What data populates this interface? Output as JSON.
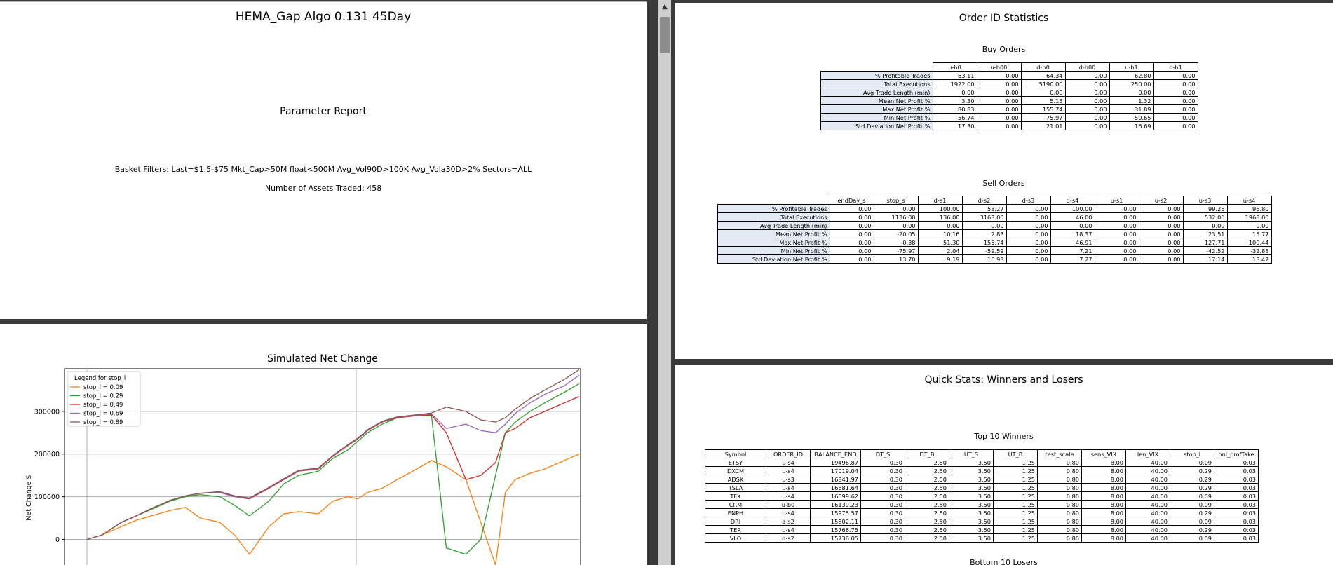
{
  "report": {
    "title": "HEMA_Gap Algo 0.131 45Day",
    "subtitle": "Parameter Report",
    "filters": "Basket Filters: Last=$1.5-$75  Mkt_Cap>50M  float<500M  Avg_Vol90D>100K  Avg_Vola30D>2%  Sectors=ALL",
    "assets": "Number of Assets Traded: 458"
  },
  "order_stats": {
    "title": "Order ID Statistics",
    "row_labels": [
      "% Profitable Trades",
      "Total Executions",
      "Avg Trade Length (min)",
      "Mean Net Profit %",
      "Max Net Profit %",
      "Min Net Profit %",
      "Std Deviation Net Profit %"
    ],
    "buy": {
      "title": "Buy Orders",
      "columns": [
        "u-b0",
        "u-b00",
        "d-b0",
        "d-b00",
        "u-b1",
        "d-b1"
      ],
      "rows": [
        [
          "63.11",
          "0.00",
          "64.34",
          "0.00",
          "62.80",
          "0.00"
        ],
        [
          "1922.00",
          "0.00",
          "5190.00",
          "0.00",
          "250.00",
          "0.00"
        ],
        [
          "0.00",
          "0.00",
          "0.00",
          "0.00",
          "0.00",
          "0.00"
        ],
        [
          "3.30",
          "0.00",
          "5.15",
          "0.00",
          "1.32",
          "0.00"
        ],
        [
          "80.83",
          "0.00",
          "155.74",
          "0.00",
          "31.89",
          "0.00"
        ],
        [
          "-56.74",
          "0.00",
          "-75.97",
          "0.00",
          "-50.65",
          "0.00"
        ],
        [
          "17.30",
          "0.00",
          "21.01",
          "0.00",
          "16.69",
          "0.00"
        ]
      ]
    },
    "sell": {
      "title": "Sell Orders",
      "columns": [
        "endDay_s",
        "stop_s",
        "d-s1",
        "d-s2",
        "d-s3",
        "d-s4",
        "u-s1",
        "u-s2",
        "u-s3",
        "u-s4"
      ],
      "rows": [
        [
          "0.00",
          "0.00",
          "100.00",
          "58.27",
          "0.00",
          "100.00",
          "0.00",
          "0.00",
          "99.25",
          "96.80"
        ],
        [
          "0.00",
          "1136.00",
          "136.00",
          "3163.00",
          "0.00",
          "46.00",
          "0.00",
          "0.00",
          "532.00",
          "1968.00"
        ],
        [
          "0.00",
          "0.00",
          "0.00",
          "0.00",
          "0.00",
          "0.00",
          "0.00",
          "0.00",
          "0.00",
          "0.00"
        ],
        [
          "0.00",
          "-20.05",
          "10.16",
          "2.83",
          "0.00",
          "18.37",
          "0.00",
          "0.00",
          "23.51",
          "15.77"
        ],
        [
          "0.00",
          "-0.38",
          "51.30",
          "155.74",
          "0.00",
          "46.91",
          "0.00",
          "0.00",
          "127.71",
          "100.44"
        ],
        [
          "0.00",
          "-75.97",
          "2.04",
          "-59.59",
          "0.00",
          "7.21",
          "0.00",
          "0.00",
          "-42.52",
          "-32.88"
        ],
        [
          "0.00",
          "13.70",
          "9.19",
          "16.93",
          "0.00",
          "7.27",
          "0.00",
          "0.00",
          "17.14",
          "13.47"
        ]
      ]
    }
  },
  "quick_stats": {
    "title": "Quick Stats: Winners and Losers",
    "winners_title": "Top 10 Winners",
    "losers_title": "Bottom 10 Losers",
    "columns": [
      "Symbol",
      "ORDER_ID",
      "BALANCE_END",
      "DT_S",
      "DT_B",
      "UT_S",
      "UT_B",
      "test_scale",
      "sens_VIX",
      "len_VIX",
      "stop_l",
      "pnl_profTake"
    ],
    "rows": [
      [
        "ETSY",
        "u-s4",
        "19496.87",
        "0.30",
        "2.50",
        "3.50",
        "1.25",
        "0.80",
        "8.00",
        "40.00",
        "0.09",
        "0.03"
      ],
      [
        "DXCM",
        "u-s4",
        "17019.04",
        "0.30",
        "2.50",
        "3.50",
        "1.25",
        "0.80",
        "8.00",
        "40.00",
        "0.29",
        "0.03"
      ],
      [
        "ADSK",
        "u-s3",
        "16841.97",
        "0.30",
        "2.50",
        "3.50",
        "1.25",
        "0.80",
        "8.00",
        "40.00",
        "0.29",
        "0.03"
      ],
      [
        "TSLA",
        "u-s4",
        "16681.64",
        "0.30",
        "2.50",
        "3.50",
        "1.25",
        "0.80",
        "8.00",
        "40.00",
        "0.29",
        "0.03"
      ],
      [
        "TFX",
        "u-s4",
        "16599.62",
        "0.30",
        "2.50",
        "3.50",
        "1.25",
        "0.80",
        "8.00",
        "40.00",
        "0.09",
        "0.03"
      ],
      [
        "CRM",
        "u-b0",
        "16139.23",
        "0.30",
        "2.50",
        "3.50",
        "1.25",
        "0.80",
        "8.00",
        "40.00",
        "0.09",
        "0.03"
      ],
      [
        "ENPH",
        "u-s4",
        "15975.57",
        "0.30",
        "2.50",
        "3.50",
        "1.25",
        "0.80",
        "8.00",
        "40.00",
        "0.29",
        "0.03"
      ],
      [
        "DRI",
        "d-s2",
        "15802.11",
        "0.30",
        "2.50",
        "3.50",
        "1.25",
        "0.80",
        "8.00",
        "40.00",
        "0.09",
        "0.03"
      ],
      [
        "TER",
        "u-s4",
        "15766.75",
        "0.30",
        "2.50",
        "3.50",
        "1.25",
        "0.80",
        "8.00",
        "40.00",
        "0.29",
        "0.03"
      ],
      [
        "VLO",
        "d-s2",
        "15736.05",
        "0.30",
        "2.50",
        "3.50",
        "1.25",
        "0.80",
        "8.00",
        "40.00",
        "0.09",
        "0.03"
      ]
    ]
  },
  "chart_data": {
    "type": "line",
    "title": "Simulated Net Change",
    "ylabel": "Net Change $",
    "xlabel": "",
    "ylim": [
      -60000,
      400000
    ],
    "yticks": [
      0,
      100000,
      200000,
      300000
    ],
    "grid": true,
    "legend_title": "Legend for stop_l",
    "legend_position": "top-left",
    "x": [
      0,
      3,
      7,
      10,
      13,
      17,
      20,
      23,
      27,
      30,
      33,
      37,
      40,
      43,
      47,
      50,
      53,
      55,
      57,
      60,
      63,
      67,
      70,
      73,
      77,
      80,
      83,
      85,
      87,
      90,
      93,
      97,
      100
    ],
    "series": [
      {
        "name": "stop_l = 0.09",
        "color": "#ff7f0e",
        "values": [
          0,
          10000,
          30000,
          45000,
          55000,
          68000,
          75000,
          50000,
          40000,
          10000,
          -35000,
          30000,
          60000,
          65000,
          60000,
          90000,
          100000,
          95000,
          110000,
          120000,
          140000,
          165000,
          185000,
          170000,
          140000,
          40000,
          -60000,
          110000,
          140000,
          155000,
          165000,
          185000,
          200000
        ]
      },
      {
        "name": "stop_l = 0.29",
        "color": "#2ca02c",
        "values": [
          0,
          10000,
          40000,
          55000,
          70000,
          90000,
          100000,
          105000,
          100000,
          80000,
          55000,
          90000,
          130000,
          150000,
          160000,
          190000,
          210000,
          230000,
          250000,
          270000,
          285000,
          290000,
          290000,
          -20000,
          -35000,
          0,
          150000,
          250000,
          275000,
          300000,
          320000,
          345000,
          365000
        ]
      },
      {
        "name": "stop_l = 0.49",
        "color": "#d62728",
        "values": [
          0,
          10000,
          40000,
          55000,
          72000,
          92000,
          102000,
          108000,
          110000,
          100000,
          95000,
          120000,
          140000,
          160000,
          165000,
          195000,
          220000,
          235000,
          255000,
          275000,
          285000,
          290000,
          292000,
          250000,
          140000,
          150000,
          180000,
          250000,
          260000,
          285000,
          300000,
          320000,
          335000
        ]
      },
      {
        "name": "stop_l = 0.69",
        "color": "#9467bd",
        "values": [
          0,
          10000,
          40000,
          55000,
          72000,
          92000,
          102000,
          108000,
          110000,
          100000,
          96000,
          121000,
          141000,
          161000,
          166000,
          196000,
          221000,
          236000,
          256000,
          276000,
          286000,
          291000,
          294000,
          260000,
          270000,
          255000,
          250000,
          270000,
          295000,
          320000,
          340000,
          360000,
          385000
        ]
      },
      {
        "name": "stop_l = 0.89",
        "color": "#8c564b",
        "values": [
          0,
          10000,
          40000,
          55000,
          72000,
          92000,
          102000,
          108000,
          112000,
          102000,
          97000,
          122000,
          142000,
          162000,
          167000,
          197000,
          222000,
          237000,
          257000,
          277000,
          287000,
          292000,
          296000,
          310000,
          300000,
          280000,
          275000,
          285000,
          305000,
          330000,
          350000,
          375000,
          398000
        ]
      }
    ]
  }
}
